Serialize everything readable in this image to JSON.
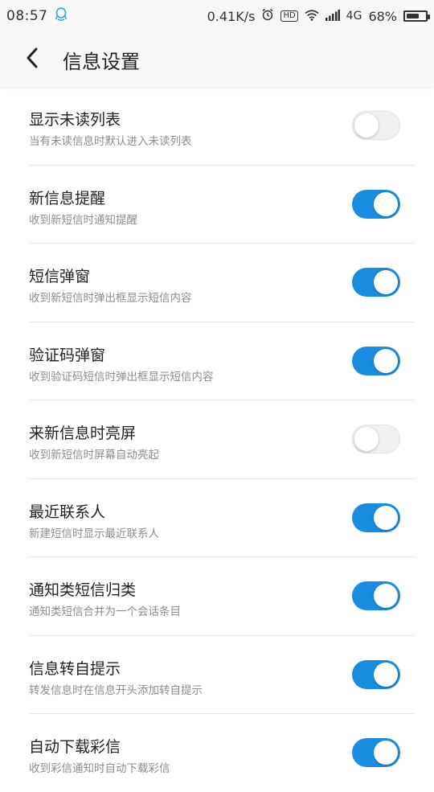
{
  "status_bar": {
    "time": "08:57",
    "speed": "0.41K/s",
    "network": "4G",
    "battery": "68%",
    "battery_level": 68,
    "icons": [
      "qq-icon",
      "alarm-icon",
      "hd-icon",
      "wifi-icon",
      "signal-icon",
      "battery-icon"
    ]
  },
  "header": {
    "title": "信息设置"
  },
  "colors": {
    "accent": "#1a8de0",
    "toggle_off": "#f0f0f0",
    "title_text": "#222222",
    "desc_text": "#8d8d8d"
  },
  "settings": [
    {
      "title": "显示未读列表",
      "desc": "当有未读信息时默认进入未读列表",
      "on": false
    },
    {
      "title": "新信息提醒",
      "desc": "收到新短信时通知提醒",
      "on": true
    },
    {
      "title": "短信弹窗",
      "desc": "收到新短信时弹出框显示短信内容",
      "on": true
    },
    {
      "title": "验证码弹窗",
      "desc": "收到验证码短信时弹出框显示短信内容",
      "on": true
    },
    {
      "title": "来新信息时亮屏",
      "desc": "收到新短信时屏幕自动亮起",
      "on": false
    },
    {
      "title": "最近联系人",
      "desc": "新建短信时显示最近联系人",
      "on": true
    },
    {
      "title": "通知类短信归类",
      "desc": "通知类短信合并为一个会话条目",
      "on": true
    },
    {
      "title": "信息转自提示",
      "desc": "转发信息时在信息开头添加转自提示",
      "on": true
    },
    {
      "title": "自动下载彩信",
      "desc": "收到彩信通知时自动下载彩信",
      "on": true
    }
  ]
}
